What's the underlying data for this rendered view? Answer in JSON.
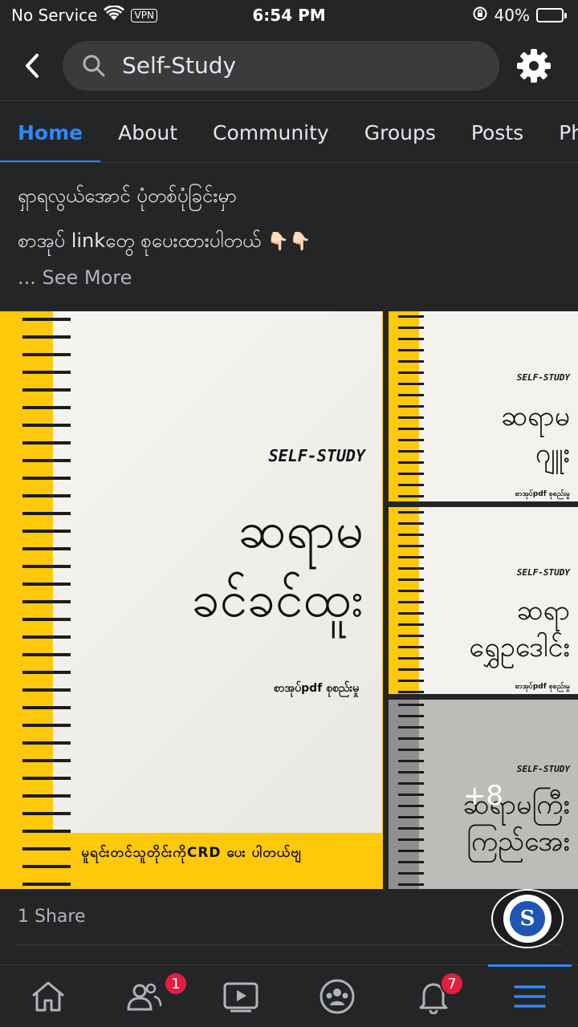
{
  "status_bar": {
    "carrier": "No Service",
    "vpn": "VPN",
    "time": "6:54 PM",
    "battery": "40%",
    "battery_level": 0.4
  },
  "search": {
    "query": "Self-Study"
  },
  "tabs": [
    {
      "label": "Home",
      "active": true
    },
    {
      "label": "About"
    },
    {
      "label": "Community"
    },
    {
      "label": "Groups"
    },
    {
      "label": "Posts"
    },
    {
      "label": "Ph"
    }
  ],
  "post": {
    "line1": "ရှာရလွယ်အောင် ပုံတစ်ပုံခြင်းမှာ",
    "line2": "စာအုပ် linkတွေ စုပေးထားပါတယ်",
    "see_more": "... See More",
    "share_count": "1 Share"
  },
  "images": {
    "main": {
      "brand": "SELF-STUDY",
      "title_line1": "ဆရာမ",
      "title_line2": "ခင်ခင်ထူး",
      "subtitle": "စာအုပ်pdf စုစည်းမှု",
      "footer": "မူရင်းတင်သူတိုင်းကိုCRD ပေး ပါတယ်ဗျ"
    },
    "side1": {
      "brand": "SELF-STUDY",
      "title_line1": "ဆရာမ",
      "title_line2": "ဂျူး",
      "subtitle": "စာအုပ်pdf စုစည်းမှု"
    },
    "side2": {
      "brand": "SELF-STUDY",
      "title_line1": "ဆရာ",
      "title_line2": "ရွှေဥဒေါင်း",
      "subtitle": "စာအုပ်pdf စုစည်းမှု"
    },
    "side3": {
      "brand": "SELF-STUDY",
      "title_line1": "ဆရာမကြီး",
      "title_line2": "ကြည်အေး",
      "more": "+8"
    }
  },
  "bottom_nav": {
    "friends_badge": "1",
    "notifications_badge": "7"
  },
  "colors": {
    "accent": "#2d88ff",
    "badge": "#e41e3f",
    "background": "#242526",
    "book_yellow": "#ffc90b"
  }
}
